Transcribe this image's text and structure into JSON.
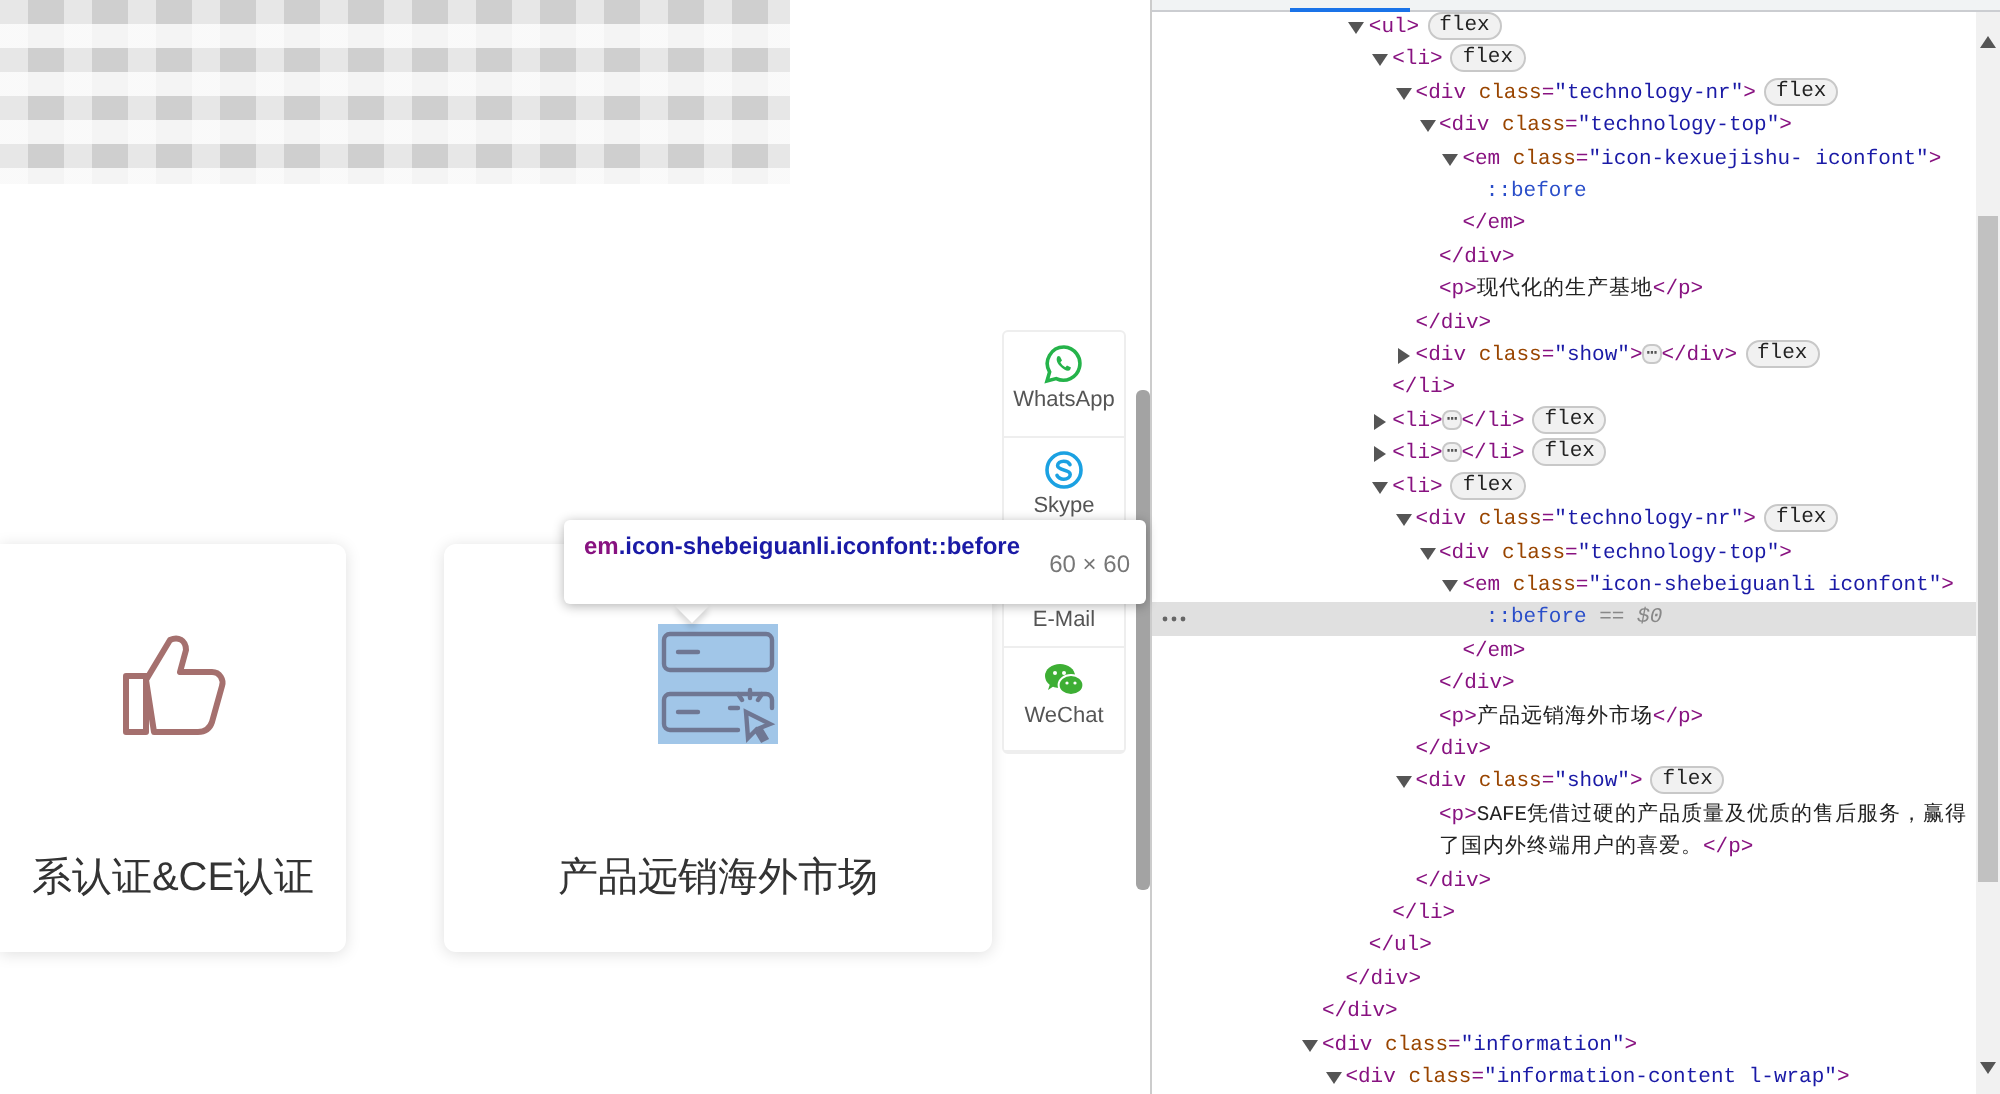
{
  "cards": [
    {
      "kind": "thumbs-up",
      "title": "系认证&CE认证",
      "inspected": false
    },
    {
      "kind": "server-panel",
      "title": "产品远销海外市场",
      "inspected": true
    }
  ],
  "contact_bar": [
    {
      "kind": "whatsapp",
      "label": "WhatsApp"
    },
    {
      "kind": "skype",
      "label": "Skype"
    },
    {
      "kind": "email",
      "label": "E-Mail"
    },
    {
      "kind": "wechat",
      "label": "WeChat"
    }
  ],
  "inspect_tooltip": {
    "selector": [
      {
        "kind": "tag",
        "text": "em"
      },
      {
        "kind": "class",
        "text": ".icon-shebeiguanli.iconfont::before"
      }
    ],
    "size": "60 × 60"
  },
  "elements_panel": {
    "tree": [
      {
        "children": [
          {
            "children": [
              {
                "selected": false,
                "expanded": true,
                "start": [
                  {
                    "kind": "tag",
                    "text": "<ul>"
                  }
                ],
                "badge": "flex",
                "children": [
                  {
                    "selected": false,
                    "expanded": true,
                    "start": [
                      {
                        "kind": "tag",
                        "text": "<li>"
                      }
                    ],
                    "badge": "flex",
                    "children": [
                      {
                        "selected": false,
                        "expanded": true,
                        "start": [
                          {
                            "kind": "tag",
                            "text": "<div "
                          },
                          {
                            "kind": "attr",
                            "text": "class"
                          },
                          {
                            "kind": "tag",
                            "text": "="
                          },
                          {
                            "kind": "val",
                            "text": "\"technology-nr\""
                          },
                          {
                            "kind": "tag",
                            "text": ">"
                          }
                        ],
                        "badge": "flex",
                        "children": [
                          {
                            "selected": false,
                            "expanded": true,
                            "start": [
                              {
                                "kind": "tag",
                                "text": "<div "
                              },
                              {
                                "kind": "attr",
                                "text": "class"
                              },
                              {
                                "kind": "tag",
                                "text": "="
                              },
                              {
                                "kind": "val",
                                "text": "\"technology-top\""
                              },
                              {
                                "kind": "tag",
                                "text": ">"
                              }
                            ],
                            "children": [
                              {
                                "selected": false,
                                "expanded": true,
                                "start": [
                                  {
                                    "kind": "tag",
                                    "text": "<em "
                                  },
                                  {
                                    "kind": "attr",
                                    "text": "class"
                                  },
                                  {
                                    "kind": "tag",
                                    "text": "="
                                  },
                                  {
                                    "kind": "val",
                                    "text": "\"icon-kexuejishu- iconfont\""
                                  },
                                  {
                                    "kind": "tag",
                                    "text": ">"
                                  }
                                ],
                                "children": [
                                  {
                                    "selected": false,
                                    "start": [
                                      {
                                        "kind": "pseudo",
                                        "text": "::before"
                                      }
                                    ]
                                  }
                                ],
                                "end": [
                                  {
                                    "kind": "tag",
                                    "text": "</em>"
                                  }
                                ]
                              }
                            ],
                            "end": [
                              {
                                "kind": "tag",
                                "text": "</div>"
                              }
                            ]
                          },
                          {
                            "selected": false,
                            "start": [
                              {
                                "kind": "tag",
                                "text": "<p>"
                              },
                              {
                                "kind": "text",
                                "text": "现代化的生产基地"
                              },
                              {
                                "kind": "tag",
                                "text": "</p>"
                              }
                            ]
                          }
                        ],
                        "end": [
                          {
                            "kind": "tag",
                            "text": "</div>"
                          }
                        ]
                      },
                      {
                        "selected": false,
                        "expanded": false,
                        "start": [
                          {
                            "kind": "tag",
                            "text": "<div "
                          },
                          {
                            "kind": "attr",
                            "text": "class"
                          },
                          {
                            "kind": "tag",
                            "text": "="
                          },
                          {
                            "kind": "val",
                            "text": "\"show\""
                          },
                          {
                            "kind": "tag",
                            "text": ">"
                          }
                        ],
                        "ellipsis": "⋯",
                        "end": [
                          {
                            "kind": "tag",
                            "text": "</div>"
                          }
                        ],
                        "badge": "flex"
                      }
                    ],
                    "end": [
                      {
                        "kind": "tag",
                        "text": "</li>"
                      }
                    ]
                  },
                  {
                    "selected": false,
                    "expanded": false,
                    "start": [
                      {
                        "kind": "tag",
                        "text": "<li>"
                      }
                    ],
                    "ellipsis": "⋯",
                    "end": [
                      {
                        "kind": "tag",
                        "text": "</li>"
                      }
                    ],
                    "badge": "flex"
                  },
                  {
                    "selected": false,
                    "expanded": false,
                    "start": [
                      {
                        "kind": "tag",
                        "text": "<li>"
                      }
                    ],
                    "ellipsis": "⋯",
                    "end": [
                      {
                        "kind": "tag",
                        "text": "</li>"
                      }
                    ],
                    "badge": "flex"
                  },
                  {
                    "selected": false,
                    "expanded": true,
                    "start": [
                      {
                        "kind": "tag",
                        "text": "<li>"
                      }
                    ],
                    "badge": "flex",
                    "children": [
                      {
                        "selected": false,
                        "expanded": true,
                        "start": [
                          {
                            "kind": "tag",
                            "text": "<div "
                          },
                          {
                            "kind": "attr",
                            "text": "class"
                          },
                          {
                            "kind": "tag",
                            "text": "="
                          },
                          {
                            "kind": "val",
                            "text": "\"technology-nr\""
                          },
                          {
                            "kind": "tag",
                            "text": ">"
                          }
                        ],
                        "badge": "flex",
                        "children": [
                          {
                            "selected": false,
                            "expanded": true,
                            "start": [
                              {
                                "kind": "tag",
                                "text": "<div "
                              },
                              {
                                "kind": "attr",
                                "text": "class"
                              },
                              {
                                "kind": "tag",
                                "text": "="
                              },
                              {
                                "kind": "val",
                                "text": "\"technology-top\""
                              },
                              {
                                "kind": "tag",
                                "text": ">"
                              }
                            ],
                            "children": [
                              {
                                "selected": false,
                                "expanded": true,
                                "start": [
                                  {
                                    "kind": "tag",
                                    "text": "<em "
                                  },
                                  {
                                    "kind": "attr",
                                    "text": "class"
                                  },
                                  {
                                    "kind": "tag",
                                    "text": "="
                                  },
                                  {
                                    "kind": "val",
                                    "text": "\"icon-shebeiguanli iconfont\""
                                  },
                                  {
                                    "kind": "tag",
                                    "text": ">"
                                  }
                                ],
                                "children": [
                                  {
                                    "selected": true,
                                    "start": [
                                      {
                                        "kind": "pseudo",
                                        "text": "::before"
                                      },
                                      {
                                        "kind": "muted",
                                        "text": " == $0"
                                      }
                                    ]
                                  }
                                ],
                                "end": [
                                  {
                                    "kind": "tag",
                                    "text": "</em>"
                                  }
                                ]
                              }
                            ],
                            "end": [
                              {
                                "kind": "tag",
                                "text": "</div>"
                              }
                            ]
                          },
                          {
                            "selected": false,
                            "start": [
                              {
                                "kind": "tag",
                                "text": "<p>"
                              },
                              {
                                "kind": "text",
                                "text": "产品远销海外市场"
                              },
                              {
                                "kind": "tag",
                                "text": "</p>"
                              }
                            ]
                          }
                        ],
                        "end": [
                          {
                            "kind": "tag",
                            "text": "</div>"
                          }
                        ]
                      },
                      {
                        "selected": false,
                        "expanded": true,
                        "start": [
                          {
                            "kind": "tag",
                            "text": "<div "
                          },
                          {
                            "kind": "attr",
                            "text": "class"
                          },
                          {
                            "kind": "tag",
                            "text": "="
                          },
                          {
                            "kind": "val",
                            "text": "\"show\""
                          },
                          {
                            "kind": "tag",
                            "text": ">"
                          }
                        ],
                        "badge": "flex",
                        "children": [
                          {
                            "selected": false,
                            "start": [
                              {
                                "kind": "tag",
                                "text": "<p>"
                              },
                              {
                                "kind": "text",
                                "text": "SAFE凭借过硬的产品质量及优质的售后服务，赢得了国内外终端用户的喜爱。"
                              },
                              {
                                "kind": "tag",
                                "text": "</p>"
                              }
                            ]
                          }
                        ],
                        "end": [
                          {
                            "kind": "tag",
                            "text": "</div>"
                          }
                        ]
                      }
                    ],
                    "end": [
                      {
                        "kind": "tag",
                        "text": "</li>"
                      }
                    ]
                  }
                ],
                "end": [
                  {
                    "kind": "tag",
                    "text": "</ul>"
                  }
                ]
              }
            ],
            "end": [
              {
                "kind": "tag",
                "text": "</div>"
              }
            ]
          }
        ],
        "end": [
          {
            "kind": "tag",
            "text": "</div>"
          }
        ]
      },
      {
        "selected": false,
        "expanded": true,
        "start": [
          {
            "kind": "tag",
            "text": "<div "
          },
          {
            "kind": "attr",
            "text": "class"
          },
          {
            "kind": "tag",
            "text": "="
          },
          {
            "kind": "val",
            "text": "\"information\""
          },
          {
            "kind": "tag",
            "text": ">"
          }
        ],
        "children": [
          {
            "selected": false,
            "expanded": true,
            "start": [
              {
                "kind": "tag",
                "text": "<div "
              },
              {
                "kind": "attr",
                "text": "class"
              },
              {
                "kind": "tag",
                "text": "="
              },
              {
                "kind": "val",
                "text": "\"information-content l-wrap\""
              },
              {
                "kind": "tag",
                "text": ">"
              }
            ]
          }
        ]
      }
    ]
  }
}
